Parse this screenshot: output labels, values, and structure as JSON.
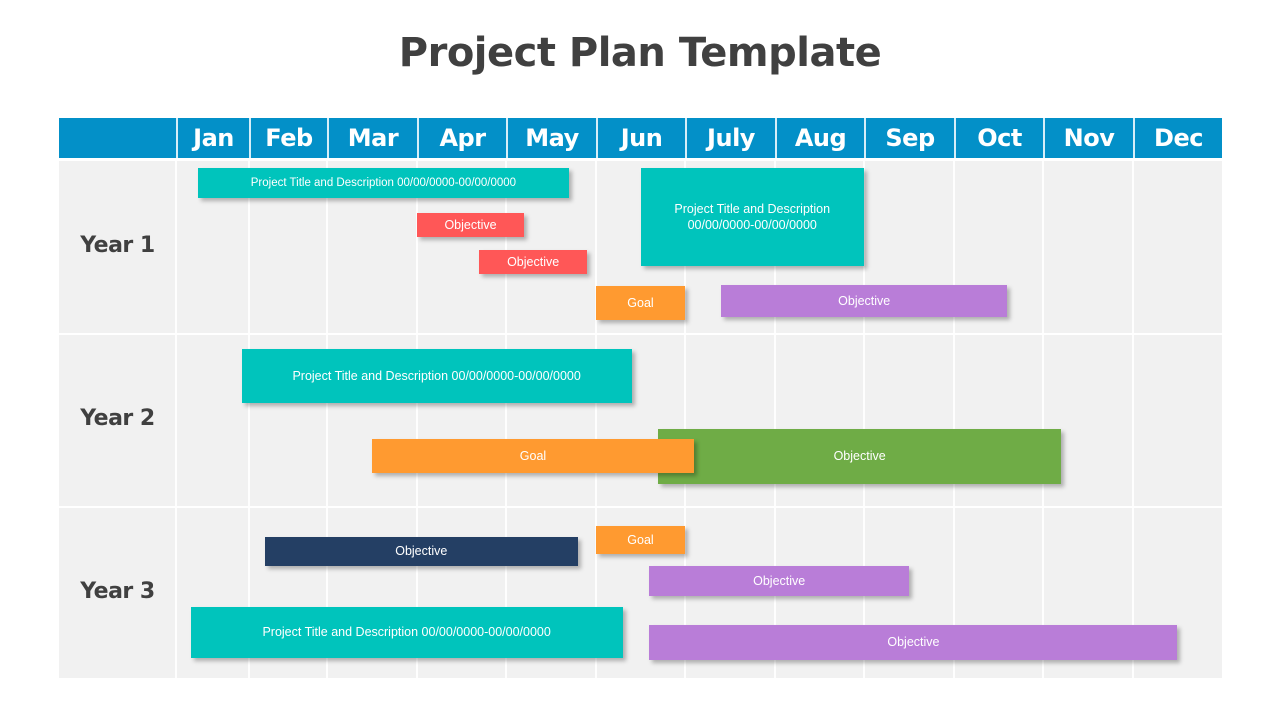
{
  "title": "Project Plan Template",
  "colors": {
    "header": "#0390c8",
    "grid_bg": "#f1f1f1",
    "teal": "#00c4bc",
    "red": "#ff5757",
    "orange": "#ff9a30",
    "purple": "#b97dd8",
    "green": "#6fac46",
    "navy": "#243f64"
  },
  "months": [
    "Jan",
    "Feb",
    "Mar",
    "Apr",
    "May",
    "Jun",
    "July",
    "Aug",
    "Sep",
    "Oct",
    "Nov",
    "Dec"
  ],
  "years": [
    {
      "label": "Year 1",
      "tasks": [
        {
          "label": "Project Title and Description 00/00/0000-00/00/0000",
          "color": "teal",
          "start_month": 1.3,
          "end_month": 5.7
        },
        {
          "label": "Objective",
          "color": "red",
          "start_month": 4.0,
          "end_month": 5.2
        },
        {
          "label": "Objective",
          "color": "red",
          "start_month": 4.7,
          "end_month": 5.9
        },
        {
          "label": "Goal",
          "color": "orange",
          "start_month": 6.0,
          "end_month": 7.0
        },
        {
          "label": "Project Title and Description 00/00/0000-00/00/0000",
          "color": "teal",
          "start_month": 6.5,
          "end_month": 9.0
        },
        {
          "label": "Objective",
          "color": "purple",
          "start_month": 7.4,
          "end_month": 10.6
        }
      ]
    },
    {
      "label": "Year 2",
      "tasks": [
        {
          "label": "Project Title and Description 00/00/0000-00/00/0000",
          "color": "teal",
          "start_month": 1.9,
          "end_month": 6.4
        },
        {
          "label": "Objective",
          "color": "green",
          "start_month": 6.7,
          "end_month": 11.2
        },
        {
          "label": "Goal",
          "color": "orange",
          "start_month": 3.5,
          "end_month": 7.1
        }
      ]
    },
    {
      "label": "Year 3",
      "tasks": [
        {
          "label": "Objective",
          "color": "navy",
          "start_month": 2.2,
          "end_month": 5.8
        },
        {
          "label": "Goal",
          "color": "orange",
          "start_month": 6.0,
          "end_month": 7.0
        },
        {
          "label": "Objective",
          "color": "purple",
          "start_month": 6.6,
          "end_month": 9.5
        },
        {
          "label": "Project Title and Description 00/00/0000-00/00/0000",
          "color": "teal",
          "start_month": 1.2,
          "end_month": 6.3
        },
        {
          "label": "Objective",
          "color": "purple",
          "start_month": 6.6,
          "end_month": 12.5
        }
      ]
    }
  ]
}
